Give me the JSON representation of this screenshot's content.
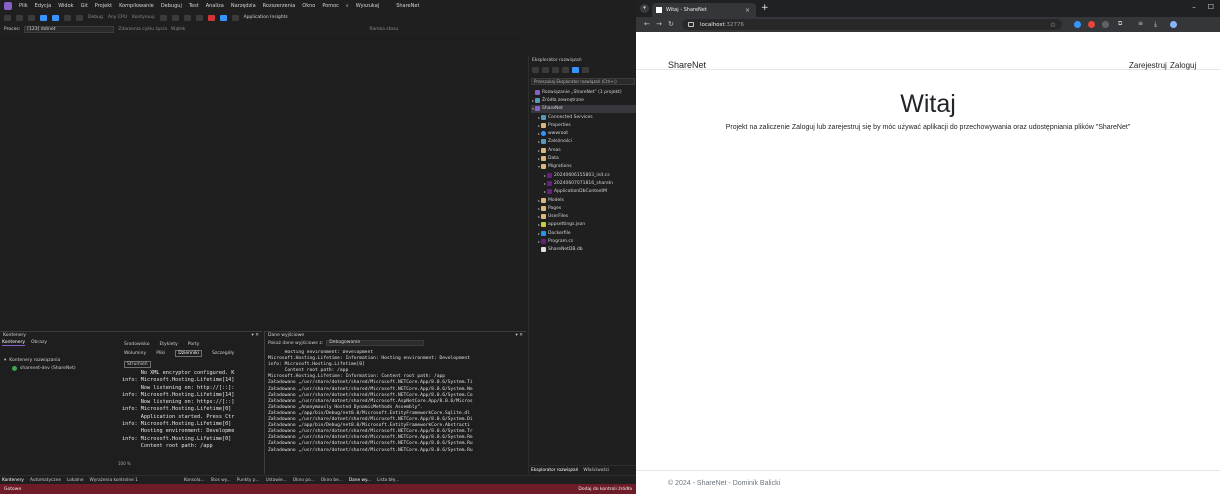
{
  "vs": {
    "menu": [
      "Plik",
      "Edycja",
      "Widok",
      "Git",
      "Projekt",
      "Kompilowanie",
      "Debuguj",
      "Test",
      "Analiza",
      "Narzędzia",
      "Rozszerzenia",
      "Okno",
      "Pomoc",
      "Wyszukaj",
      "ShareNet"
    ],
    "toolbar": {
      "config": "Debug",
      "platform": "Any CPU",
      "continue": "Kontynuuj",
      "insights": "Application Insights"
    },
    "procbar": {
      "process": "[123] dotnet",
      "lifecycle": "Zdarzenia cyklu życia",
      "thread": "Wątek",
      "stack": "Ramka stosu"
    },
    "solution": {
      "title": "Eksplorator rozwiązań",
      "search": "Przeszukaj Eksplorator rozwiązań (Ctrl+;)",
      "tree": [
        {
          "label": "Rozwiązanie „ShareNet” (1 projekt)",
          "indent": 0,
          "icon": "sln",
          "tw": ""
        },
        {
          "label": "Źródła zewnętrzne",
          "indent": 0,
          "icon": "link",
          "tw": "▸"
        },
        {
          "label": "ShareNet",
          "indent": 0,
          "icon": "proj",
          "tw": "▾",
          "selected": true
        },
        {
          "label": "Connected Services",
          "indent": 1,
          "icon": "link",
          "tw": "▸"
        },
        {
          "label": "Properties",
          "indent": 1,
          "icon": "folder",
          "tw": "▸"
        },
        {
          "label": "wwwroot",
          "indent": 1,
          "icon": "globe",
          "tw": "▸"
        },
        {
          "label": "Zależności",
          "indent": 1,
          "icon": "link",
          "tw": "▸"
        },
        {
          "label": "Areas",
          "indent": 1,
          "icon": "folder",
          "tw": "▸"
        },
        {
          "label": "Data",
          "indent": 1,
          "icon": "folder",
          "tw": "▸"
        },
        {
          "label": "Migrations",
          "indent": 1,
          "icon": "folder",
          "tw": "▾"
        },
        {
          "label": "20240606155803_init.cs",
          "indent": 2,
          "icon": "cs",
          "tw": "▸"
        },
        {
          "label": "20240607071816_shareIn",
          "indent": 2,
          "icon": "cs",
          "tw": "▸"
        },
        {
          "label": "ApplicationDbContextM",
          "indent": 2,
          "icon": "cs",
          "tw": "▸"
        },
        {
          "label": "Models",
          "indent": 1,
          "icon": "folder",
          "tw": "▸"
        },
        {
          "label": "Pages",
          "indent": 1,
          "icon": "folder",
          "tw": "▸"
        },
        {
          "label": "UserFiles",
          "indent": 1,
          "icon": "folder",
          "tw": "▸"
        },
        {
          "label": "appsettings.json",
          "indent": 1,
          "icon": "json",
          "tw": "▸"
        },
        {
          "label": "Dockerfile",
          "indent": 1,
          "icon": "docker",
          "tw": "▸"
        },
        {
          "label": "Program.cs",
          "indent": 1,
          "icon": "cs",
          "tw": "▸"
        },
        {
          "label": "ShareNetDB.db",
          "indent": 1,
          "icon": "db",
          "tw": ""
        }
      ],
      "bottom_tabs": [
        "Eksplorator rozwiązań",
        "Właściwości"
      ]
    },
    "containers": {
      "title": "Kontenery",
      "tabs": [
        "Kontenery",
        "Obrazy"
      ],
      "tree_root": "Kontenery rozwiązania",
      "item": "sharenet-dev (ShareNet)",
      "detail_tabs": [
        "Środowisko",
        "Etykiety",
        "Porty",
        "Woluminy",
        "Pliki",
        "Dzienniki",
        "Szczegóły"
      ],
      "stream": "Strumień",
      "zoom": "100 %",
      "log": [
        "      No XML encryptor configured. K",
        "info: Microsoft.Hosting.Lifetime[14]",
        "      Now listening on: http://[::]:",
        "info: Microsoft.Hosting.Lifetime[14]",
        "      Now listening on: https://[::]",
        "info: Microsoft.Hosting.Lifetime[0]",
        "      Application started. Press Ctr",
        "info: Microsoft.Hosting.Lifetime[0]",
        "      Hosting environment: Developme",
        "info: Microsoft.Hosting.Lifetime[0]",
        "      Content root path: /app"
      ]
    },
    "output": {
      "title": "Dane wyjściowe",
      "show_label": "Pokaż dane wyjściowe z:",
      "source": "Debugowanie",
      "log": [
        "      Hosting environment: Development",
        "Microsoft.Hosting.Lifetime: Information: Hosting environment: Development",
        "info: Microsoft.Hosting.Lifetime[0]",
        "      Content root path: /app",
        "Microsoft.Hosting.Lifetime: Information: Content root path: /app",
        "Załadowano „/usr/share/dotnet/shared/Microsoft.NETCore.App/8.0.6/System.Ti",
        "Załadowano „/usr/share/dotnet/shared/Microsoft.NETCore.App/8.0.6/System.Ne",
        "Załadowano „/usr/share/dotnet/shared/Microsoft.NETCore.App/8.0.6/System.Co",
        "Załadowano „/usr/share/dotnet/shared/Microsoft.AspNetCore.App/8.0.6/Micros",
        "Załadowano „Anonymously Hosted DynamicMethods Assembly”.",
        "Załadowano „/app/bin/Debug/net8.0/Microsoft.EntityFrameworkCore.Sqlite.dl",
        "Załadowano „/usr/share/dotnet/shared/Microsoft.NETCore.App/8.0.6/System.Di",
        "Załadowano „/app/bin/Debug/net8.0/Microsoft.EntityFrameworkCore.Abstracti",
        "Załadowano „/usr/share/dotnet/shared/Microsoft.NETCore.App/8.0.6/System.Tr",
        "Załadowano „/usr/share/dotnet/shared/Microsoft.NETCore.App/8.0.6/System.Re",
        "Załadowano „/usr/share/dotnet/shared/Microsoft.NETCore.App/8.0.6/System.Ru",
        "Załadowano „/usr/share/dotnet/shared/Microsoft.NETCore.App/8.0.6/System.Ru"
      ]
    },
    "bottom_tabs": [
      "Kontenery",
      "Automatyczne",
      "Lokalne",
      "Wyrażenia kontrolne 1",
      "Konsola...",
      "Stos wy...",
      "Punkty p...",
      "Ustawie...",
      "Okno po...",
      "Okno be...",
      "Dane wy...",
      "Lista błę..."
    ],
    "status": {
      "left": "Gotowe",
      "right": "Dodaj do kontroli źródła"
    }
  },
  "browser": {
    "tab_title": "Witaj - ShareNet",
    "close_glyph": "×",
    "newtab_glyph": "+",
    "url_host": "localhost",
    "url_port": ":32776",
    "brand": "ShareNet",
    "nav": {
      "register": "Zarejestruj",
      "login": "Zaloguj"
    },
    "hero_title": "Witaj",
    "hero_text": "Projekt na zaliczenie Zaloguj lub zarejestruj się by móc używać aplikacji do przechowywania oraz udostępniania plików \"ShareNet\"",
    "footer": "© 2024 - ShareNet - Dominik Balicki"
  }
}
